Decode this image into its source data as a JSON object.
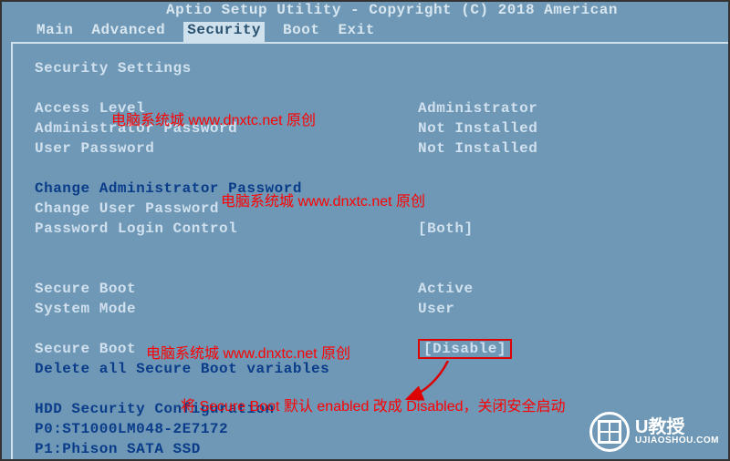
{
  "title": "Aptio Setup Utility - Copyright (C) 2018 American",
  "menu": {
    "items": [
      "Main",
      "Advanced",
      "Security",
      "Boot",
      "Exit"
    ],
    "active_index": 2
  },
  "section_title": "Security Settings",
  "rows": {
    "access_level": {
      "label": "Access Level",
      "value": "Administrator"
    },
    "admin_pw": {
      "label": "Administrator Password",
      "value": "Not Installed"
    },
    "user_pw": {
      "label": "User Password",
      "value": "Not Installed"
    },
    "change_admin": {
      "label": "Change Administrator Password"
    },
    "change_user": {
      "label": "Change User Password"
    },
    "login_ctrl": {
      "label": "Password Login Control",
      "value": "[Both]"
    },
    "secure_boot_state": {
      "label": "Secure Boot",
      "value": "Active"
    },
    "system_mode": {
      "label": "System Mode",
      "value": "User"
    },
    "secure_boot_set": {
      "label": "Secure Boot",
      "value": "[Disable]"
    },
    "delete_sb": {
      "label": "Delete all Secure Boot variables"
    },
    "hdd_sec": {
      "label": "HDD Security Configuration"
    },
    "hdd0": {
      "label": "P0:ST1000LM048-2E7172"
    },
    "hdd1": {
      "label": "P1:Phison SATA SSD"
    }
  },
  "annotations": {
    "watermark": "电脑系统城 www.dnxtc.net 原创",
    "instruction": "将 Secure Boot 默认 enabled 改成 Disabled，关闭安全启动"
  },
  "logo": {
    "brand": "U教授",
    "url": "UJIAOSHOU.COM"
  }
}
